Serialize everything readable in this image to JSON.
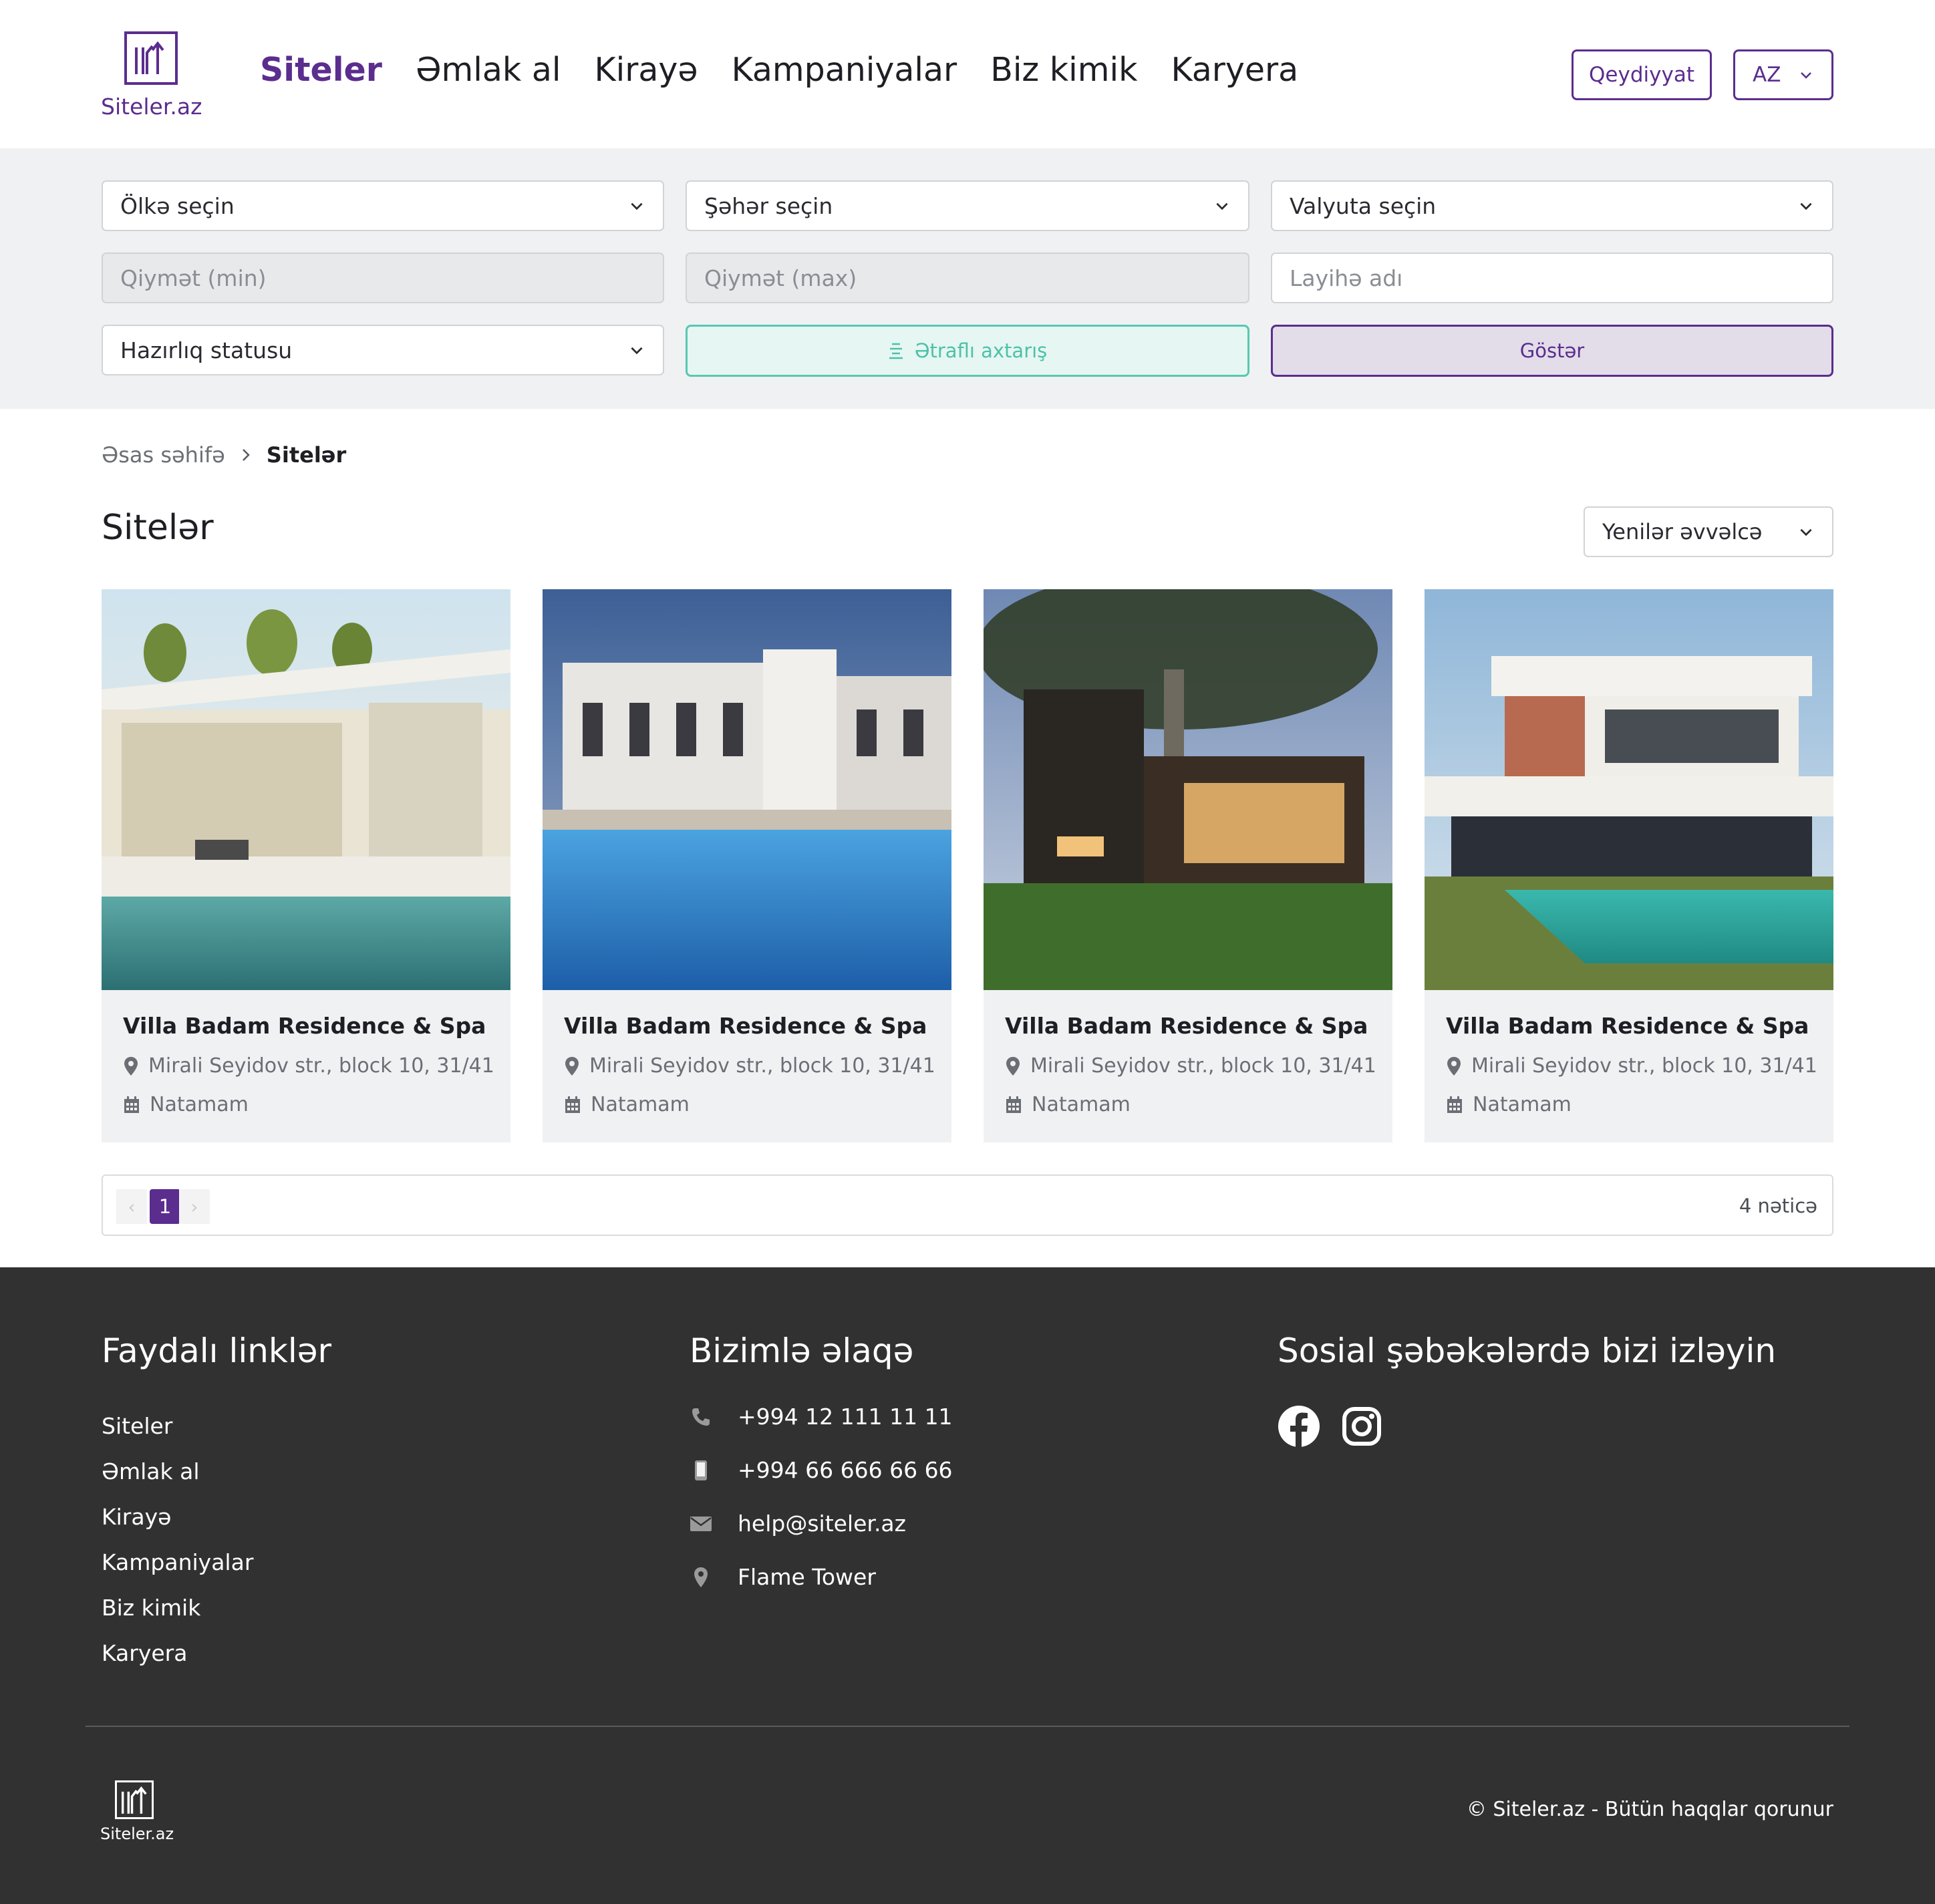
{
  "header": {
    "logo_text": "Siteler.az",
    "nav": [
      "Siteler",
      "Əmlak al",
      "Kirayə",
      "Kampaniyalar",
      "Biz kimik",
      "Karyera"
    ],
    "register_label": "Qeydiyyat",
    "lang_label": "AZ"
  },
  "filters": {
    "country": "Ölkə seçin",
    "city": "Şəhər seçin",
    "currency": "Valyuta seçin",
    "price_min": "Qiymət (min)",
    "price_max": "Qiymət (max)",
    "project_name": "Layihə adı",
    "status": "Hazırlıq statusu",
    "advanced_label": "Ətraflı axtarış",
    "show_label": "Göstər"
  },
  "breadcrumb": {
    "home": "Əsas səhifə",
    "current": "Sitelər"
  },
  "page": {
    "title": "Sitelər",
    "sort_label": "Yenilər əvvəlcə"
  },
  "cards": [
    {
      "title": "Villa Badam Residence & Spa",
      "address": "Mirali Seyidov str., block 10, 31/41",
      "status": "Natamam"
    },
    {
      "title": "Villa Badam Residence & Spa",
      "address": "Mirali Seyidov str., block 10, 31/41",
      "status": "Natamam"
    },
    {
      "title": "Villa Badam Residence & Spa",
      "address": "Mirali Seyidov str., block 10, 31/41",
      "status": "Natamam"
    },
    {
      "title": "Villa Badam Residence & Spa",
      "address": "Mirali Seyidov str., block 10, 31/41",
      "status": "Natamam"
    }
  ],
  "pagination": {
    "prev": "‹",
    "current": "1",
    "next": "›",
    "count": "4 nəticə"
  },
  "footer": {
    "links_heading": "Faydalı linklər",
    "links": [
      "Siteler",
      "Əmlak al",
      "Kirayə",
      "Kampaniyalar",
      "Biz kimik",
      "Karyera"
    ],
    "contact_heading": "Bizimlə əlaqə",
    "phone": "+994 12 111 11 11",
    "mobile": "+994 66 666 66 66",
    "email": "help@siteler.az",
    "address": "Flame Tower",
    "social_heading": "Sosial şəbəkələrdə bizi izləyin",
    "social_icons": [
      "facebook-icon",
      "instagram-icon"
    ],
    "logo_text": "Siteler.az",
    "copyright": "© Siteler.az - Bütün haqqlar qorunur"
  },
  "colors": {
    "brand": "#5b2d8e",
    "accent": "#58c8b2",
    "footer_bg": "#313131",
    "filter_bg": "#f0f1f2"
  }
}
